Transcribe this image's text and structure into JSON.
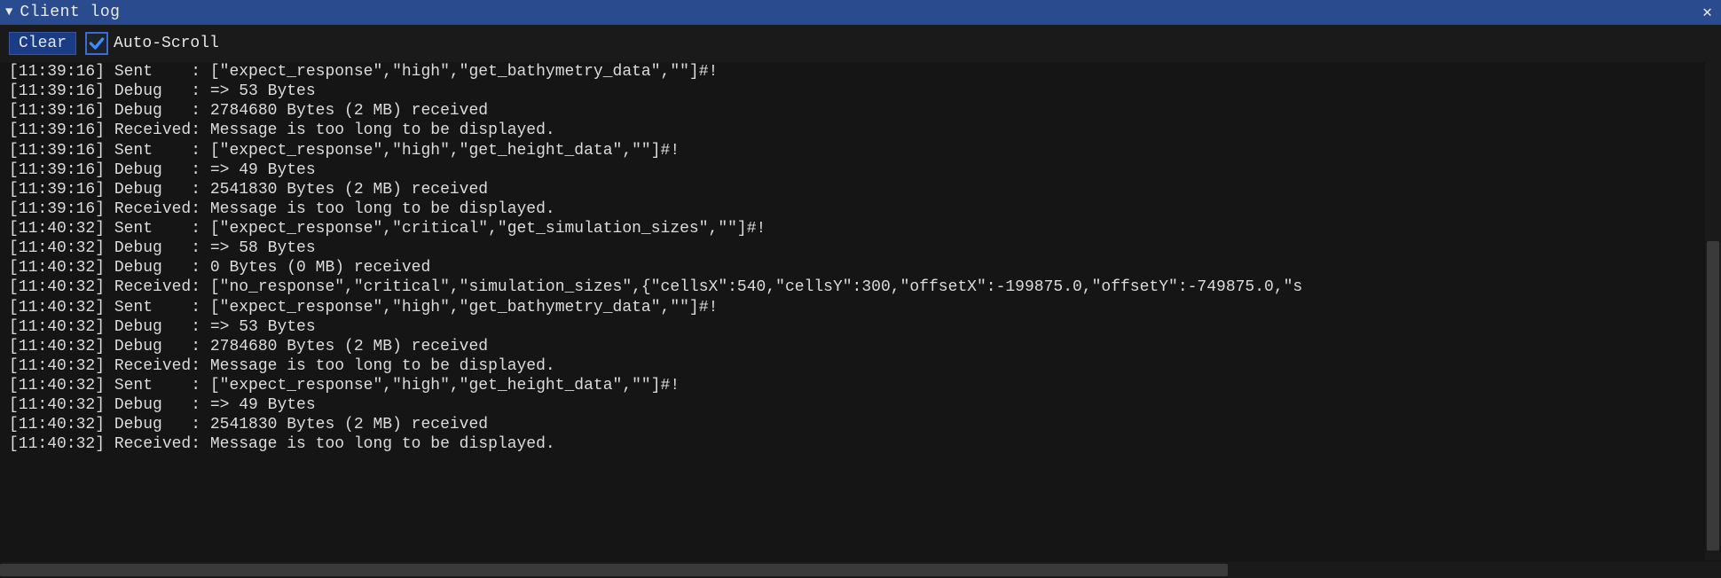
{
  "window": {
    "title": "Client log",
    "collapse_glyph": "▼",
    "close_glyph": "✕"
  },
  "toolbar": {
    "clear_label": "Clear",
    "autoscroll_label": "Auto-Scroll",
    "autoscroll_checked": true
  },
  "log": {
    "lines": [
      {
        "time": "11:39:16",
        "level": "Sent",
        "msg": "[\"expect_response\",\"high\",\"get_bathymetry_data\",\"\"]#!"
      },
      {
        "time": "11:39:16",
        "level": "Debug",
        "msg": "=> 53 Bytes"
      },
      {
        "time": "11:39:16",
        "level": "Debug",
        "msg": "2784680 Bytes (2 MB) received"
      },
      {
        "time": "11:39:16",
        "level": "Received",
        "msg": "Message is too long to be displayed."
      },
      {
        "time": "11:39:16",
        "level": "Sent",
        "msg": "[\"expect_response\",\"high\",\"get_height_data\",\"\"]#!"
      },
      {
        "time": "11:39:16",
        "level": "Debug",
        "msg": "=> 49 Bytes"
      },
      {
        "time": "11:39:16",
        "level": "Debug",
        "msg": "2541830 Bytes (2 MB) received"
      },
      {
        "time": "11:39:16",
        "level": "Received",
        "msg": "Message is too long to be displayed."
      },
      {
        "time": "11:40:32",
        "level": "Sent",
        "msg": "[\"expect_response\",\"critical\",\"get_simulation_sizes\",\"\"]#!"
      },
      {
        "time": "11:40:32",
        "level": "Debug",
        "msg": "=> 58 Bytes"
      },
      {
        "time": "11:40:32",
        "level": "Debug",
        "msg": "0 Bytes (0 MB) received"
      },
      {
        "time": "11:40:32",
        "level": "Received",
        "msg": "[\"no_response\",\"critical\",\"simulation_sizes\",{\"cellsX\":540,\"cellsY\":300,\"offsetX\":-199875.0,\"offsetY\":-749875.0,\"s"
      },
      {
        "time": "11:40:32",
        "level": "Sent",
        "msg": "[\"expect_response\",\"high\",\"get_bathymetry_data\",\"\"]#!"
      },
      {
        "time": "11:40:32",
        "level": "Debug",
        "msg": "=> 53 Bytes"
      },
      {
        "time": "11:40:32",
        "level": "Debug",
        "msg": "2784680 Bytes (2 MB) received"
      },
      {
        "time": "11:40:32",
        "level": "Received",
        "msg": "Message is too long to be displayed."
      },
      {
        "time": "11:40:32",
        "level": "Sent",
        "msg": "[\"expect_response\",\"high\",\"get_height_data\",\"\"]#!"
      },
      {
        "time": "11:40:32",
        "level": "Debug",
        "msg": "=> 49 Bytes"
      },
      {
        "time": "11:40:32",
        "level": "Debug",
        "msg": "2541830 Bytes (2 MB) received"
      },
      {
        "time": "11:40:32",
        "level": "Received",
        "msg": "Message is too long to be displayed."
      }
    ]
  }
}
